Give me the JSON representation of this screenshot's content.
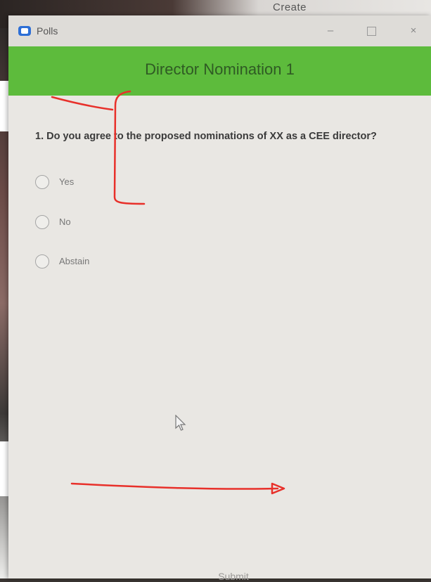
{
  "background": {
    "partial_text": "Create"
  },
  "window": {
    "title": "Polls",
    "controls": {
      "minimize": "–",
      "close": "×"
    }
  },
  "poll": {
    "title": "Director Nomination 1",
    "question": "1. Do you agree to the proposed nominations of XX as a CEE director?",
    "options": [
      {
        "label": "Yes",
        "selected": false
      },
      {
        "label": "No",
        "selected": false
      },
      {
        "label": "Abstain",
        "selected": false
      }
    ],
    "submit_label": "Submit"
  },
  "colors": {
    "banner": "#5dbb3c",
    "banner_text": "#2f5a24",
    "annotation": "#e8302a",
    "app_icon": "#2d6fd6"
  }
}
